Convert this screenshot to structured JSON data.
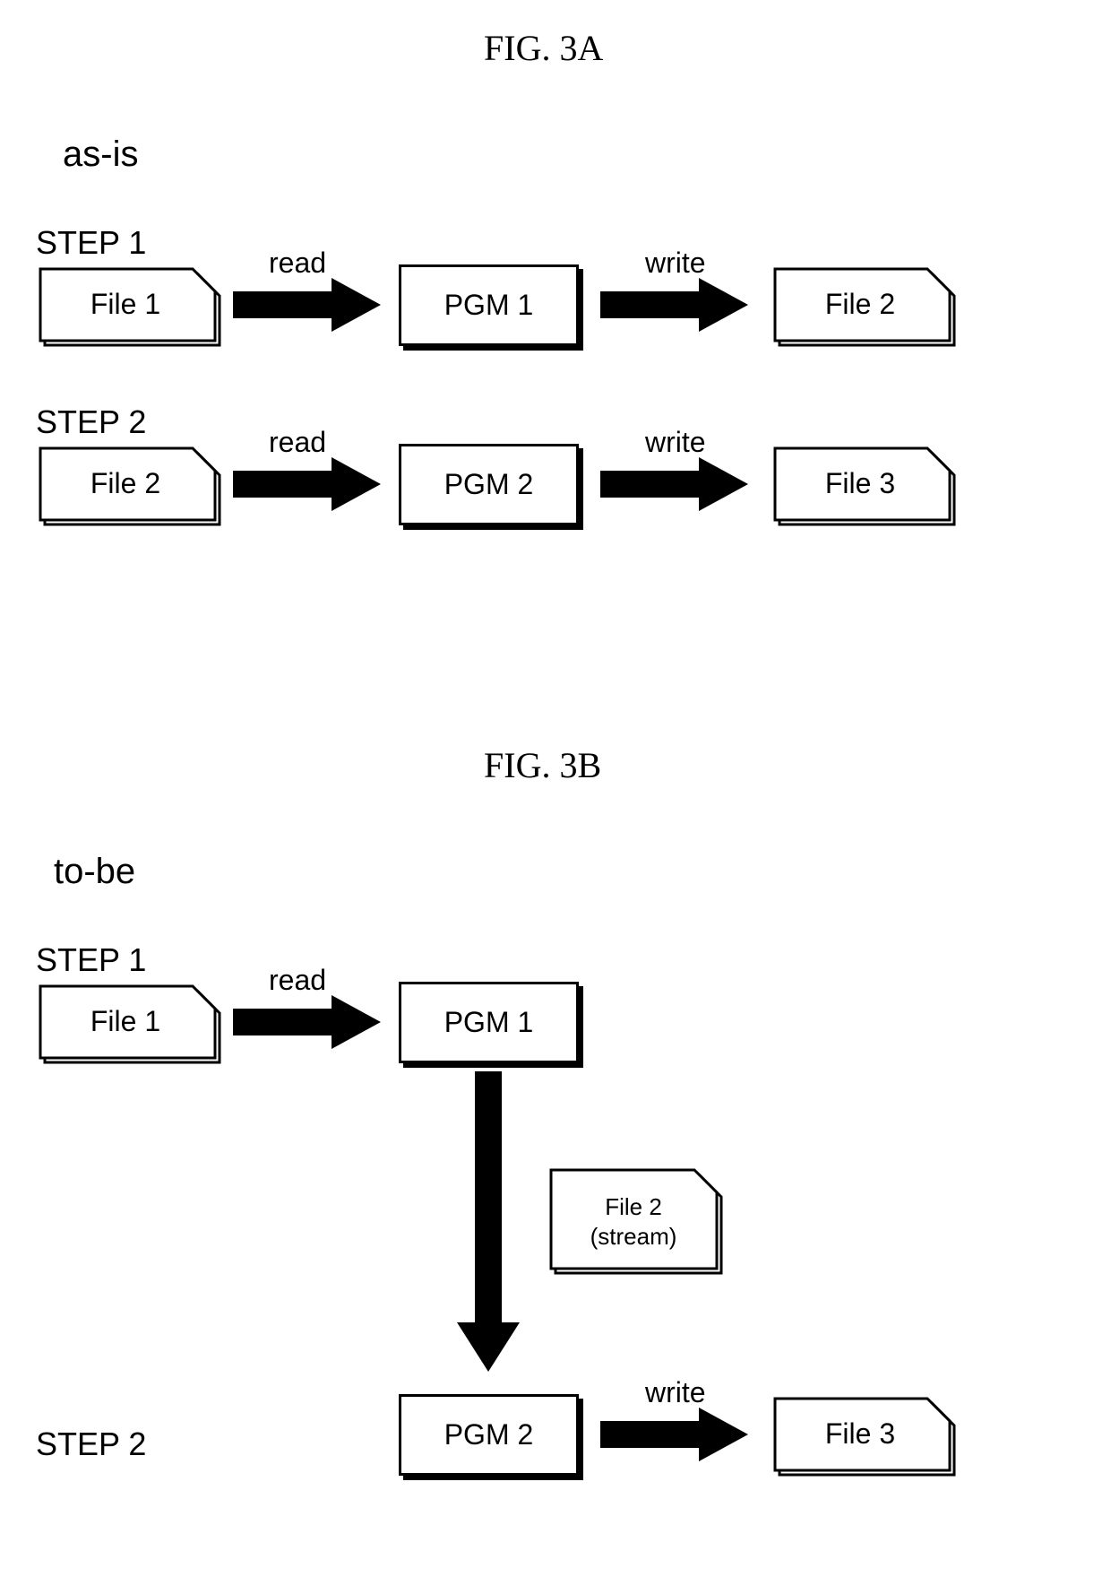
{
  "figA": {
    "title": "FIG. 3A",
    "section": "as-is",
    "step1": {
      "label": "STEP 1",
      "file1": "File 1",
      "arrow1": "read",
      "pgm": "PGM 1",
      "arrow2": "write",
      "file2": "File 2"
    },
    "step2": {
      "label": "STEP 2",
      "file1": "File 2",
      "arrow1": "read",
      "pgm": "PGM 2",
      "arrow2": "write",
      "file2": "File 3"
    }
  },
  "figB": {
    "title": "FIG. 3B",
    "section": "to-be",
    "step1": {
      "label": "STEP 1",
      "file1": "File 1",
      "arrow1": "read",
      "pgm": "PGM 1"
    },
    "stream": {
      "line1": "File 2",
      "line2": "(stream)"
    },
    "step2": {
      "label": "STEP 2",
      "pgm": "PGM 2",
      "arrow": "write",
      "file": "File 3"
    }
  }
}
